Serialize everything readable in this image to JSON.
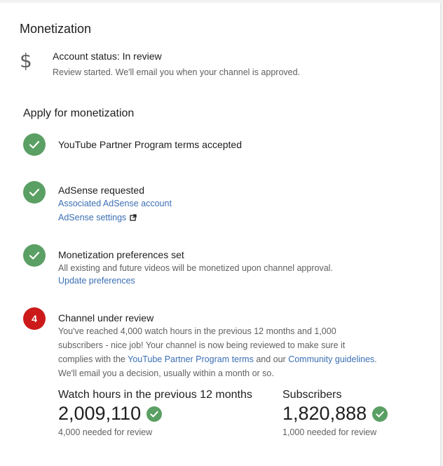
{
  "monetization": {
    "title": "Monetization",
    "account_status": "Account status: In review",
    "account_desc": "Review started. We'll email you when your channel is approved."
  },
  "apply": {
    "title": "Apply for monetization",
    "steps": [
      {
        "title": "YouTube Partner Program terms accepted"
      },
      {
        "title": "AdSense requested",
        "link1": "Associated AdSense account",
        "link2": "AdSense settings"
      },
      {
        "title": "Monetization preferences set",
        "desc": "All existing and future videos will be monetized upon channel approval.",
        "link": "Update preferences"
      },
      {
        "number": "4",
        "title": "Channel under review",
        "desc1": "You've reached 4,000 watch hours in the previous 12 months and 1,000",
        "desc2": "subscribers - nice job! Your channel is now being reviewed to make sure it",
        "desc3_pre": "complies with the ",
        "desc3_link1": "YouTube Partner Program terms",
        "desc3_mid": " and our ",
        "desc3_link2": "Community guidelines",
        "desc3_post": ".",
        "desc4": "We'll email you a decision, usually within a month or so."
      }
    ]
  },
  "metrics": {
    "watch": {
      "label": "Watch hours in the previous 12 months",
      "value": "2,009,110",
      "note": "4,000 needed for review"
    },
    "subs": {
      "label": "Subscribers",
      "value": "1,820,888",
      "note": "1,000 needed for review"
    }
  },
  "colors": {
    "check_green": "#5a9f63",
    "number_red": "#cc1a1a",
    "link_blue": "#3b6fb4"
  },
  "icons": {
    "account": "dollar-icon",
    "done": "check-icon",
    "external": "external-link-icon"
  }
}
